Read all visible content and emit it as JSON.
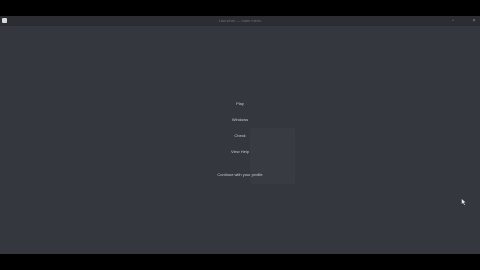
{
  "window": {
    "title": "Launcher — main menu",
    "restore_glyph": "▫",
    "close_glyph": "×"
  },
  "menu": {
    "items": [
      {
        "label": "Play"
      },
      {
        "label": "Windows"
      },
      {
        "label": "Check"
      },
      {
        "label": "View Help"
      },
      {
        "label": "Continue with your profile"
      }
    ]
  },
  "colors": {
    "window_bg": "#34373d",
    "titlebar_bg": "#2b2d32",
    "text": "#c8cacf"
  },
  "icons": {
    "app": "app-icon",
    "cursor": "mouse-pointer-icon"
  }
}
